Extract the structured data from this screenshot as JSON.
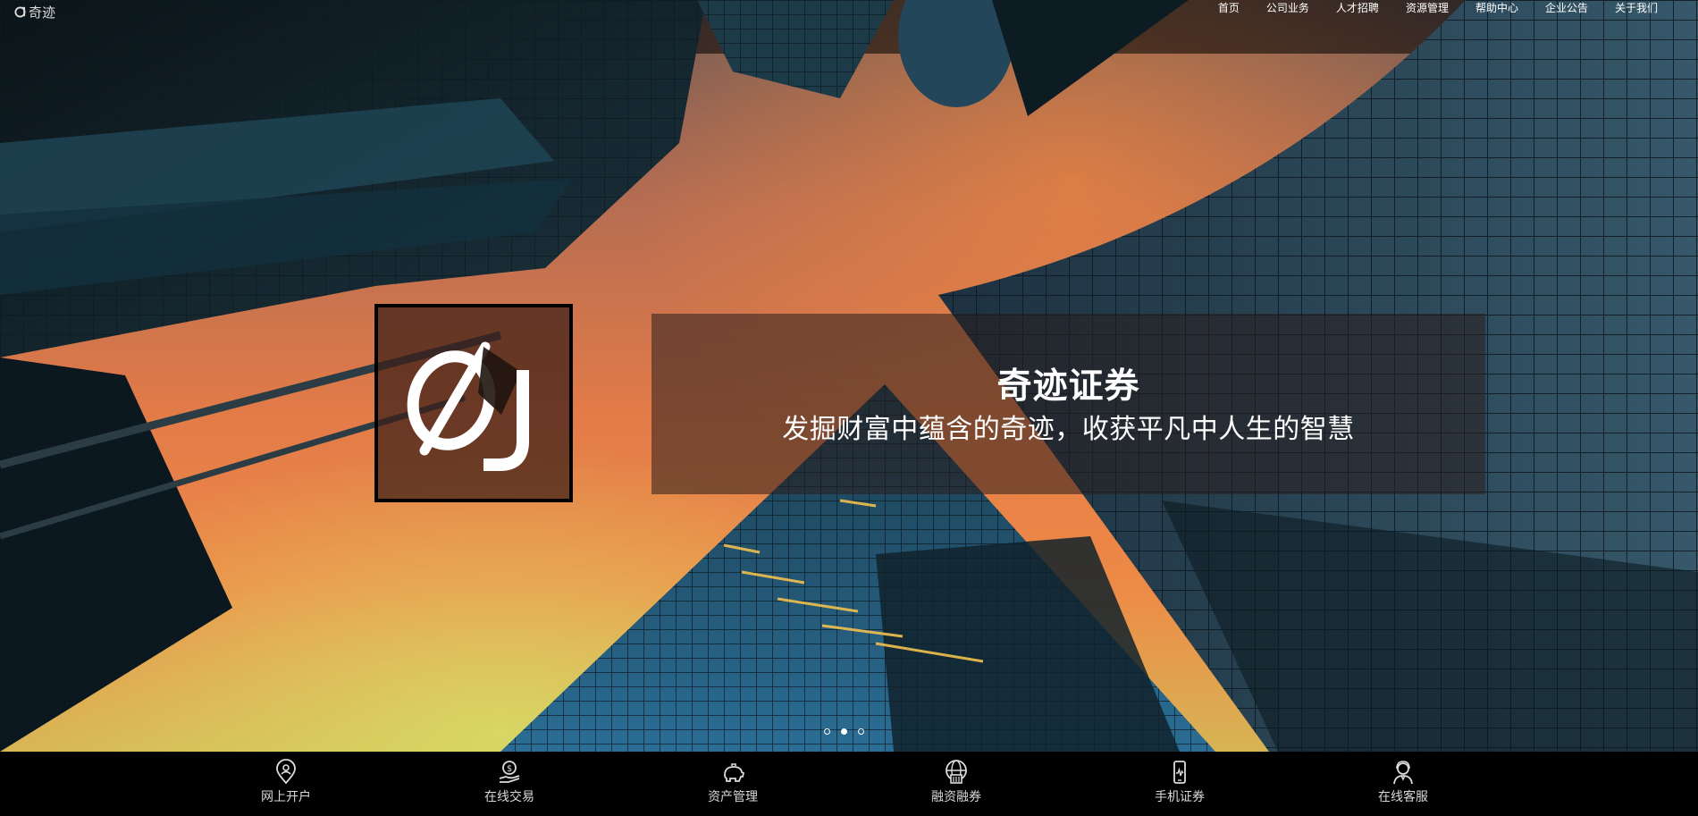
{
  "brand": {
    "name": "奇迹",
    "icon": "brand-logo-icon"
  },
  "nav": {
    "items": [
      {
        "label": "首页"
      },
      {
        "label": "公司业务"
      },
      {
        "label": "人才招聘"
      },
      {
        "label": "资源管理"
      },
      {
        "label": "帮助中心"
      },
      {
        "label": "企业公告"
      },
      {
        "label": "关于我们"
      }
    ]
  },
  "hero": {
    "logo_icon": "qj-logo-icon",
    "title": "奇迹证券",
    "subtitle": "发掘财富中蕴含的奇迹，收获平凡中人生的智慧",
    "carousel": {
      "slide_count": 3,
      "active_index": 1
    }
  },
  "services": {
    "items": [
      {
        "label": "网上开户",
        "icon": "location-person-icon"
      },
      {
        "label": "在线交易",
        "icon": "dollar-hand-icon"
      },
      {
        "label": "资产管理",
        "icon": "piggy-bank-icon"
      },
      {
        "label": "融资融券",
        "icon": "globe-building-icon"
      },
      {
        "label": "手机证券",
        "icon": "mobile-chart-icon"
      },
      {
        "label": "在线客服",
        "icon": "support-agent-icon"
      }
    ]
  },
  "colors": {
    "bar_background": "#000000",
    "text": "#ffffff",
    "sky_orange": "#ee8a47"
  }
}
